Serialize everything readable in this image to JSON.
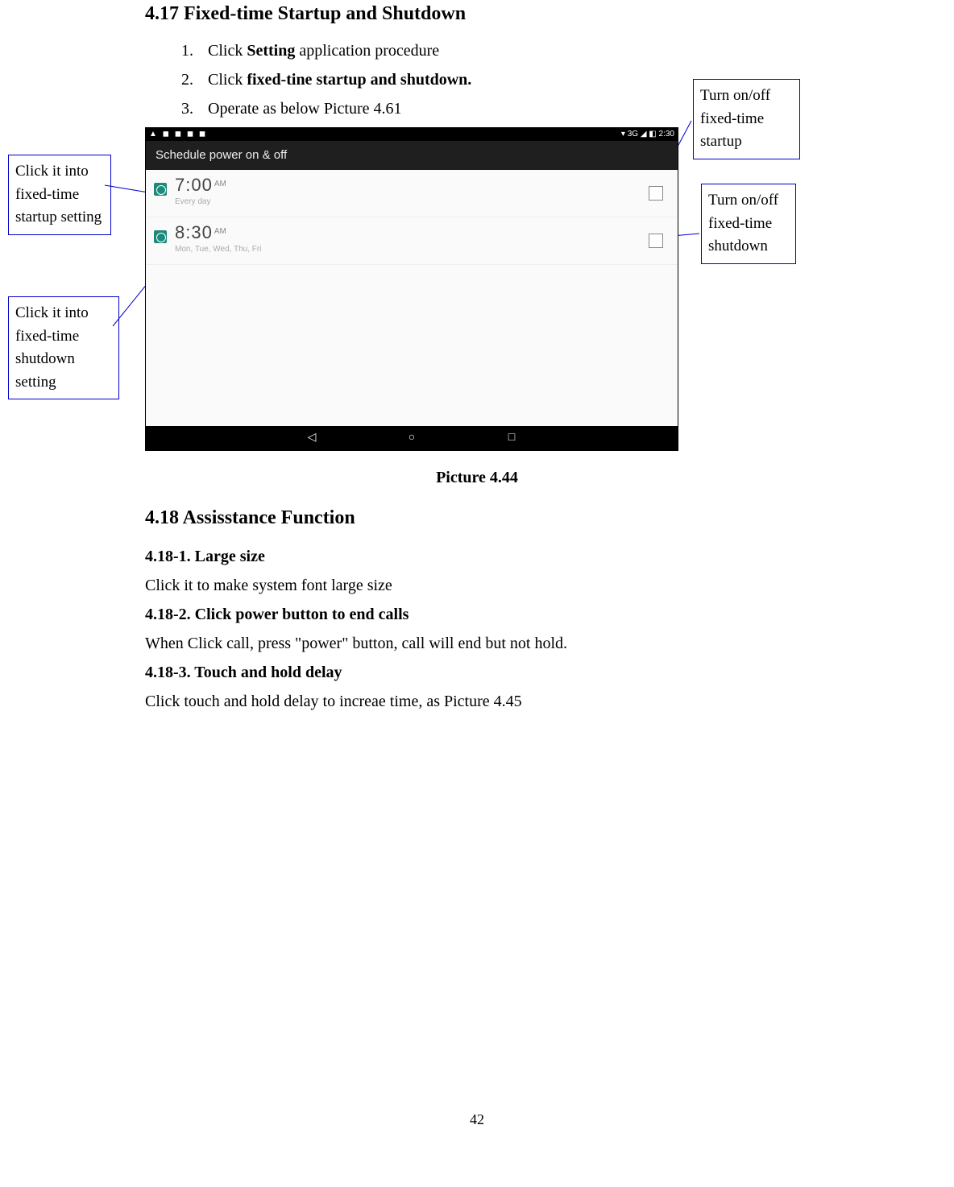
{
  "section417": {
    "heading": "4.17 Fixed-time Startup and Shutdown",
    "steps": {
      "n1": "1.",
      "t1a": "Click ",
      "t1b": "Setting",
      "t1c": " application procedure",
      "n2": "2.",
      "t2a": "Click ",
      "t2b": "fixed-tine startup and shutdown.",
      "n3": "3.",
      "t3": "Operate as below Picture 4.61"
    }
  },
  "callouts": {
    "a": "Click it into fixed-time startup setting",
    "b": "Click it into fixed-time shutdown setting",
    "c": "Turn  on/off fixed-time startup",
    "d": "Turn on/off fixed-time shutdown"
  },
  "screenshot": {
    "status_left": "▲ ◼ ◼ ◼ ◼",
    "status_right": "▾ 3G ◢ ◧ 2:30",
    "appbar_title": "Schedule power on & off",
    "row1": {
      "time": "7:00",
      "ampm": "AM",
      "sub": "Every day"
    },
    "row2": {
      "time": "8:30",
      "ampm": "AM",
      "sub": "Mon, Tue, Wed, Thu, Fri"
    },
    "nav_back": "◁",
    "nav_home": "○",
    "nav_recent": "□"
  },
  "figure_caption": "Picture 4.44",
  "section418": {
    "heading": "4.18 Assisstance Function",
    "sub1": "4.18-1. Large size",
    "p1": "Click it to make system font large size",
    "sub2": "4.18-2. Click power button to end calls",
    "p2": "When Click call, press \"power\" button, call will end but not hold.",
    "sub3": "4.18-3. Touch and hold delay",
    "p3": "Click touch and hold delay to increae time, as Picture 4.45"
  },
  "page_number": "42"
}
